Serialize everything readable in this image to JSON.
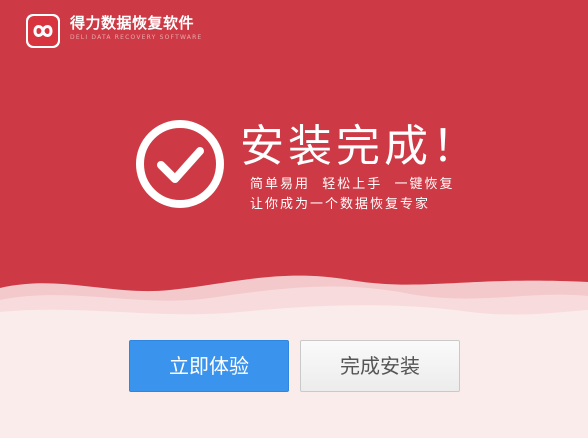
{
  "app": {
    "title": "得力数据恢复软件",
    "subtitle": "DELI DATA RECOVERY SOFTWARE"
  },
  "hero": {
    "headline": "安装完成！",
    "slogan_line1": "简单易用  轻松上手  一键恢复",
    "slogan_line2": "让你成为一个数据恢复专家"
  },
  "buttons": {
    "try_now": "立即体验",
    "finish_install": "完成安装"
  },
  "colors": {
    "hero_red": "#cd3a45",
    "primary_blue": "#3a93ec",
    "page_bg": "#fbecec"
  },
  "icons": {
    "logo": "infinity-logo-icon",
    "check": "check-circle-icon"
  }
}
